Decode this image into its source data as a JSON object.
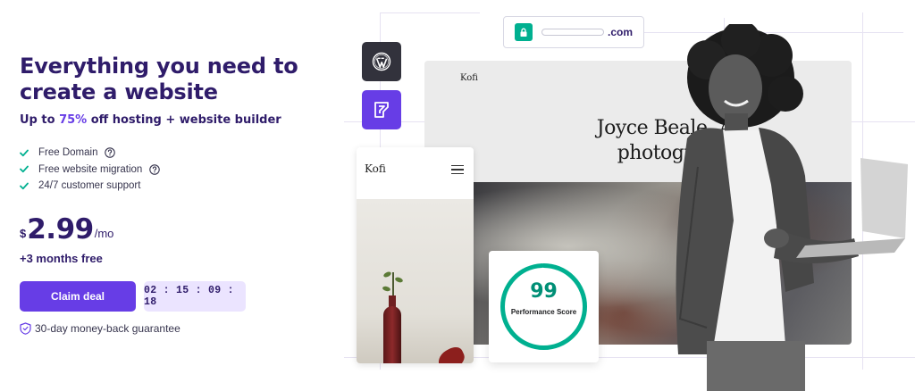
{
  "hero": {
    "headline": "Everything you need to create a website",
    "subhead_prefix": "Up to ",
    "subhead_accent": "75%",
    "subhead_suffix": " off hosting + website builder",
    "features": [
      {
        "label": "Free Domain",
        "has_help": true
      },
      {
        "label": "Free website migration",
        "has_help": true
      },
      {
        "label": "24/7 customer support",
        "has_help": false
      }
    ],
    "price": {
      "currency": "$",
      "amount": "2.99",
      "period": "/mo"
    },
    "bonus": "+3 months free",
    "cta_label": "Claim deal",
    "countdown": "02 : 15 : 09 : 18",
    "guarantee": "30-day money-back guarantee"
  },
  "visual": {
    "url_suffix": ".com",
    "desktop_brand": "Kofi",
    "desktop_title": "Joyce Beale, Art photograph",
    "mobile_brand": "Kofi",
    "score_value": "99",
    "score_label": "Performance Score",
    "score_fraction": 0.99
  },
  "colors": {
    "brand": "#673de6",
    "heading": "#2f1c6a",
    "success": "#00b090",
    "timer_bg": "#ebe4ff"
  },
  "icons": [
    "check-icon",
    "help-icon",
    "shield-icon",
    "lock-icon",
    "wordpress-icon",
    "website-builder-icon",
    "menu-icon"
  ]
}
